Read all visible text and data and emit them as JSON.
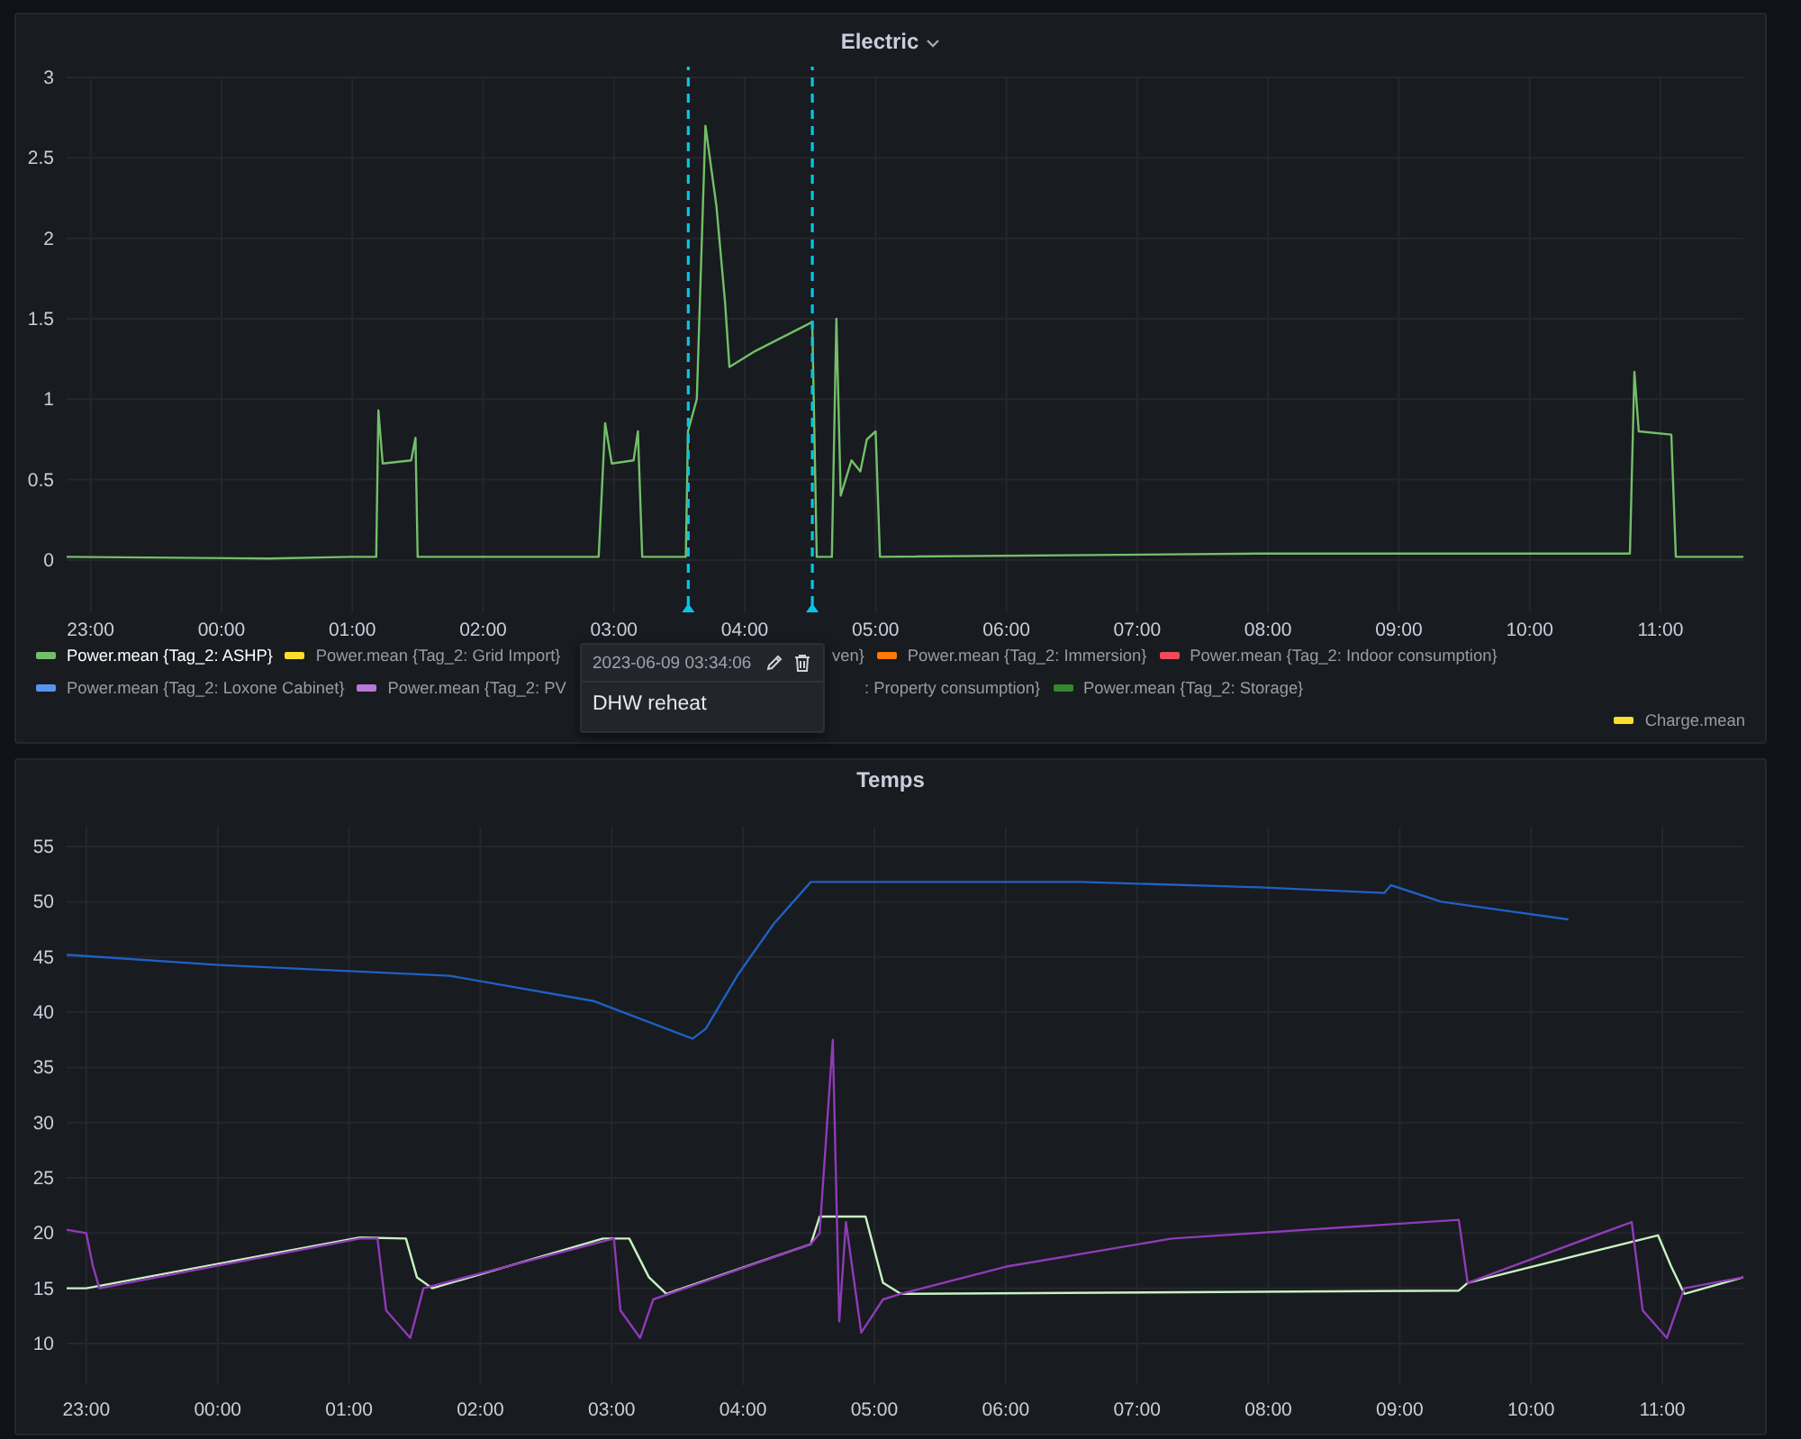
{
  "electric": {
    "title": "Electric",
    "chart_data": {
      "type": "line",
      "grid": true,
      "xlim": [
        "2023-06-08T22:49",
        "2023-06-09T11:38"
      ],
      "ylim": [
        -0.325,
        3.0
      ],
      "xticks": [
        {
          "value": "2023-06-08T23:00",
          "label": "23:00"
        },
        {
          "value": "2023-06-09T00:00",
          "label": "00:00"
        },
        {
          "value": "2023-06-09T01:00",
          "label": "01:00"
        },
        {
          "value": "2023-06-09T02:00",
          "label": "02:00"
        },
        {
          "value": "2023-06-09T03:00",
          "label": "03:00"
        },
        {
          "value": "2023-06-09T04:00",
          "label": "04:00"
        },
        {
          "value": "2023-06-09T05:00",
          "label": "05:00"
        },
        {
          "value": "2023-06-09T06:00",
          "label": "06:00"
        },
        {
          "value": "2023-06-09T07:00",
          "label": "07:00"
        },
        {
          "value": "2023-06-09T08:00",
          "label": "08:00"
        },
        {
          "value": "2023-06-09T09:00",
          "label": "09:00"
        },
        {
          "value": "2023-06-09T10:00",
          "label": "10:00"
        },
        {
          "value": "2023-06-09T11:00",
          "label": "11:00"
        }
      ],
      "yticks": [
        0,
        {
          "value": 0.5,
          "label": "0.5"
        },
        1,
        {
          "value": 1.5,
          "label": "1.5"
        },
        2,
        {
          "value": 2.5,
          "label": "2.5"
        },
        3
      ],
      "ref_lines": [
        {
          "axis": "x",
          "value": "2023-06-09T03:34:06"
        },
        {
          "axis": "x",
          "value": "2023-06-09T04:31"
        }
      ],
      "series": [
        {
          "color": "#73bf69",
          "x": [
            "2023-06-08T22:49",
            "2023-06-09T00:22",
            "2023-06-09T00:59",
            "2023-06-09T01:11",
            "2023-06-09T01:12",
            "2023-06-09T01:14",
            "2023-06-09T01:27",
            "2023-06-09T01:29",
            "2023-06-09T01:30",
            "2023-06-09T02:53",
            "2023-06-09T02:56",
            "2023-06-09T02:59",
            "2023-06-09T03:09",
            "2023-06-09T03:11",
            "2023-06-09T03:13",
            "2023-06-09T03:33",
            "2023-06-09T03:34",
            "2023-06-09T03:38",
            "2023-06-09T03:42",
            "2023-06-09T03:47",
            "2023-06-09T03:51",
            "2023-06-09T03:53",
            "2023-06-09T04:05",
            "2023-06-09T04:31",
            "2023-06-09T04:33",
            "2023-06-09T04:40",
            "2023-06-09T04:42",
            "2023-06-09T04:44",
            "2023-06-09T04:49",
            "2023-06-09T04:53",
            "2023-06-09T04:56",
            "2023-06-09T05:00",
            "2023-06-09T05:02",
            "2023-06-09T07:56",
            "2023-06-09T10:46",
            "2023-06-09T10:48",
            "2023-06-09T10:50",
            "2023-06-09T11:05",
            "2023-06-09T11:07",
            "2023-06-09T11:38"
          ],
          "values": [
            0.02,
            0.01,
            0.02,
            0.02,
            0.93,
            0.6,
            0.62,
            0.76,
            0.02,
            0.02,
            0.85,
            0.6,
            0.62,
            0.8,
            0.02,
            0.02,
            0.8,
            1.0,
            2.7,
            2.2,
            1.6,
            1.2,
            1.3,
            1.48,
            0.02,
            0.02,
            1.5,
            0.4,
            0.62,
            0.55,
            0.75,
            0.8,
            0.02,
            0.04,
            0.04,
            1.17,
            0.8,
            0.78,
            0.02,
            0.02
          ]
        }
      ]
    },
    "legend": [
      {
        "items": [
          {
            "label": "Power.mean {Tag_2: ASHP}",
            "color": "#73bf69",
            "selected": true
          },
          {
            "label": "Power.mean {Tag_2: Grid Import}",
            "color": "#fade2a",
            "selected": false
          },
          {
            "label": "ven}",
            "selected": false
          },
          {
            "label": "Power.mean {Tag_2: Immersion}",
            "color": "#ff780a",
            "selected": false
          },
          {
            "label": "Power.mean {Tag_2: Indoor consumption}",
            "color": "#f2495c",
            "selected": false
          }
        ]
      },
      {
        "items": [
          {
            "label": "Power.mean {Tag_2: Loxone Cabinet}",
            "color": "#5794f2",
            "selected": false
          },
          {
            "label": "Power.mean {Tag_2: PV",
            "color": "#b877d9",
            "selected": false
          },
          {
            "label": ": Property consumption}",
            "selected": false
          },
          {
            "label": "Power.mean {Tag_2: Storage}",
            "color": "#37872d",
            "selected": false
          }
        ]
      },
      {
        "items": [
          {
            "label": "Charge.mean",
            "color": "#fade2a",
            "selected": false
          }
        ]
      }
    ],
    "annotation_tooltip": {
      "time": "2023-06-09 03:34:06",
      "text": "DHW reheat"
    }
  },
  "temps": {
    "title": "Temps",
    "chart_data": {
      "type": "line",
      "grid": true,
      "xlim": [
        "2023-06-08T22:51",
        "2023-06-09T11:37"
      ],
      "ylim": [
        6.25,
        56.8
      ],
      "xticks": [
        {
          "value": "2023-06-08T23:00",
          "label": "23:00"
        },
        {
          "value": "2023-06-09T00:00",
          "label": "00:00"
        },
        {
          "value": "2023-06-09T01:00",
          "label": "01:00"
        },
        {
          "value": "2023-06-09T02:00",
          "label": "02:00"
        },
        {
          "value": "2023-06-09T03:00",
          "label": "03:00"
        },
        {
          "value": "2023-06-09T04:00",
          "label": "04:00"
        },
        {
          "value": "2023-06-09T05:00",
          "label": "05:00"
        },
        {
          "value": "2023-06-09T06:00",
          "label": "06:00"
        },
        {
          "value": "2023-06-09T07:00",
          "label": "07:00"
        },
        {
          "value": "2023-06-09T08:00",
          "label": "08:00"
        },
        {
          "value": "2023-06-09T09:00",
          "label": "09:00"
        },
        {
          "value": "2023-06-09T10:00",
          "label": "10:00"
        },
        {
          "value": "2023-06-09T11:00",
          "label": "11:00"
        }
      ],
      "yticks": [
        10,
        15,
        20,
        25,
        30,
        35,
        40,
        45,
        50,
        55
      ],
      "series": [
        {
          "color": "#1f60c4",
          "x": [
            "2023-06-08T22:51",
            "2023-06-08T23:59",
            "2023-06-09T01:46",
            "2023-06-09T02:52",
            "2023-06-09T03:37",
            "2023-06-09T03:43",
            "2023-06-09T03:58",
            "2023-06-09T04:14",
            "2023-06-09T04:31",
            "2023-06-09T06:34",
            "2023-06-09T07:56",
            "2023-06-09T08:53",
            "2023-06-09T08:56",
            "2023-06-09T09:19",
            "2023-06-09T10:17"
          ],
          "values": [
            45.2,
            44.3,
            43.3,
            41.0,
            37.6,
            38.5,
            43.5,
            48,
            51.8,
            51.8,
            51.3,
            50.8,
            51.5,
            50,
            48.4
          ]
        },
        {
          "color": "#c8f2c2",
          "x": [
            "2023-06-08T22:51",
            "2023-06-08T23:00",
            "2023-06-09T01:05",
            "2023-06-09T01:26",
            "2023-06-09T01:31",
            "2023-06-09T01:38",
            "2023-06-09T02:56",
            "2023-06-09T03:08",
            "2023-06-09T03:17",
            "2023-06-09T03:25",
            "2023-06-09T04:31",
            "2023-06-09T04:35",
            "2023-06-09T04:56",
            "2023-06-09T05:04",
            "2023-06-09T05:12",
            "2023-06-09T09:27",
            "2023-06-09T09:31",
            "2023-06-09T10:58",
            "2023-06-09T11:04",
            "2023-06-09T11:10",
            "2023-06-09T11:37"
          ],
          "values": [
            15,
            15,
            19.6,
            19.5,
            16,
            15,
            19.5,
            19.5,
            16,
            14.5,
            19,
            21.5,
            21.5,
            15.5,
            14.5,
            14.8,
            15.5,
            19.8,
            17,
            14.5,
            16
          ]
        },
        {
          "color": "#8f3bb8",
          "x": [
            "2023-06-08T22:51",
            "2023-06-08T23:00",
            "2023-06-08T23:03",
            "2023-06-08T23:06",
            "2023-06-09T01:05",
            "2023-06-09T01:13",
            "2023-06-09T01:17",
            "2023-06-09T01:28",
            "2023-06-09T01:34",
            "2023-06-09T03:01",
            "2023-06-09T03:04",
            "2023-06-09T03:13",
            "2023-06-09T03:19",
            "2023-06-09T04:31",
            "2023-06-09T04:35",
            "2023-06-09T04:41",
            "2023-06-09T04:44",
            "2023-06-09T04:47",
            "2023-06-09T04:54",
            "2023-06-09T05:04",
            "2023-06-09T05:12",
            "2023-06-09T06:01",
            "2023-06-09T07:16",
            "2023-06-09T09:27",
            "2023-06-09T09:31",
            "2023-06-09T10:46",
            "2023-06-09T10:51",
            "2023-06-09T11:02",
            "2023-06-09T11:10",
            "2023-06-09T11:37"
          ],
          "values": [
            20.3,
            20,
            17,
            15,
            19.5,
            19.5,
            13,
            10.5,
            15,
            19.5,
            13,
            10.5,
            14,
            19,
            20,
            37.5,
            12,
            21,
            11,
            14,
            14.5,
            17,
            19.5,
            21.2,
            15.5,
            21,
            13,
            10.5,
            15,
            16
          ]
        }
      ]
    }
  }
}
